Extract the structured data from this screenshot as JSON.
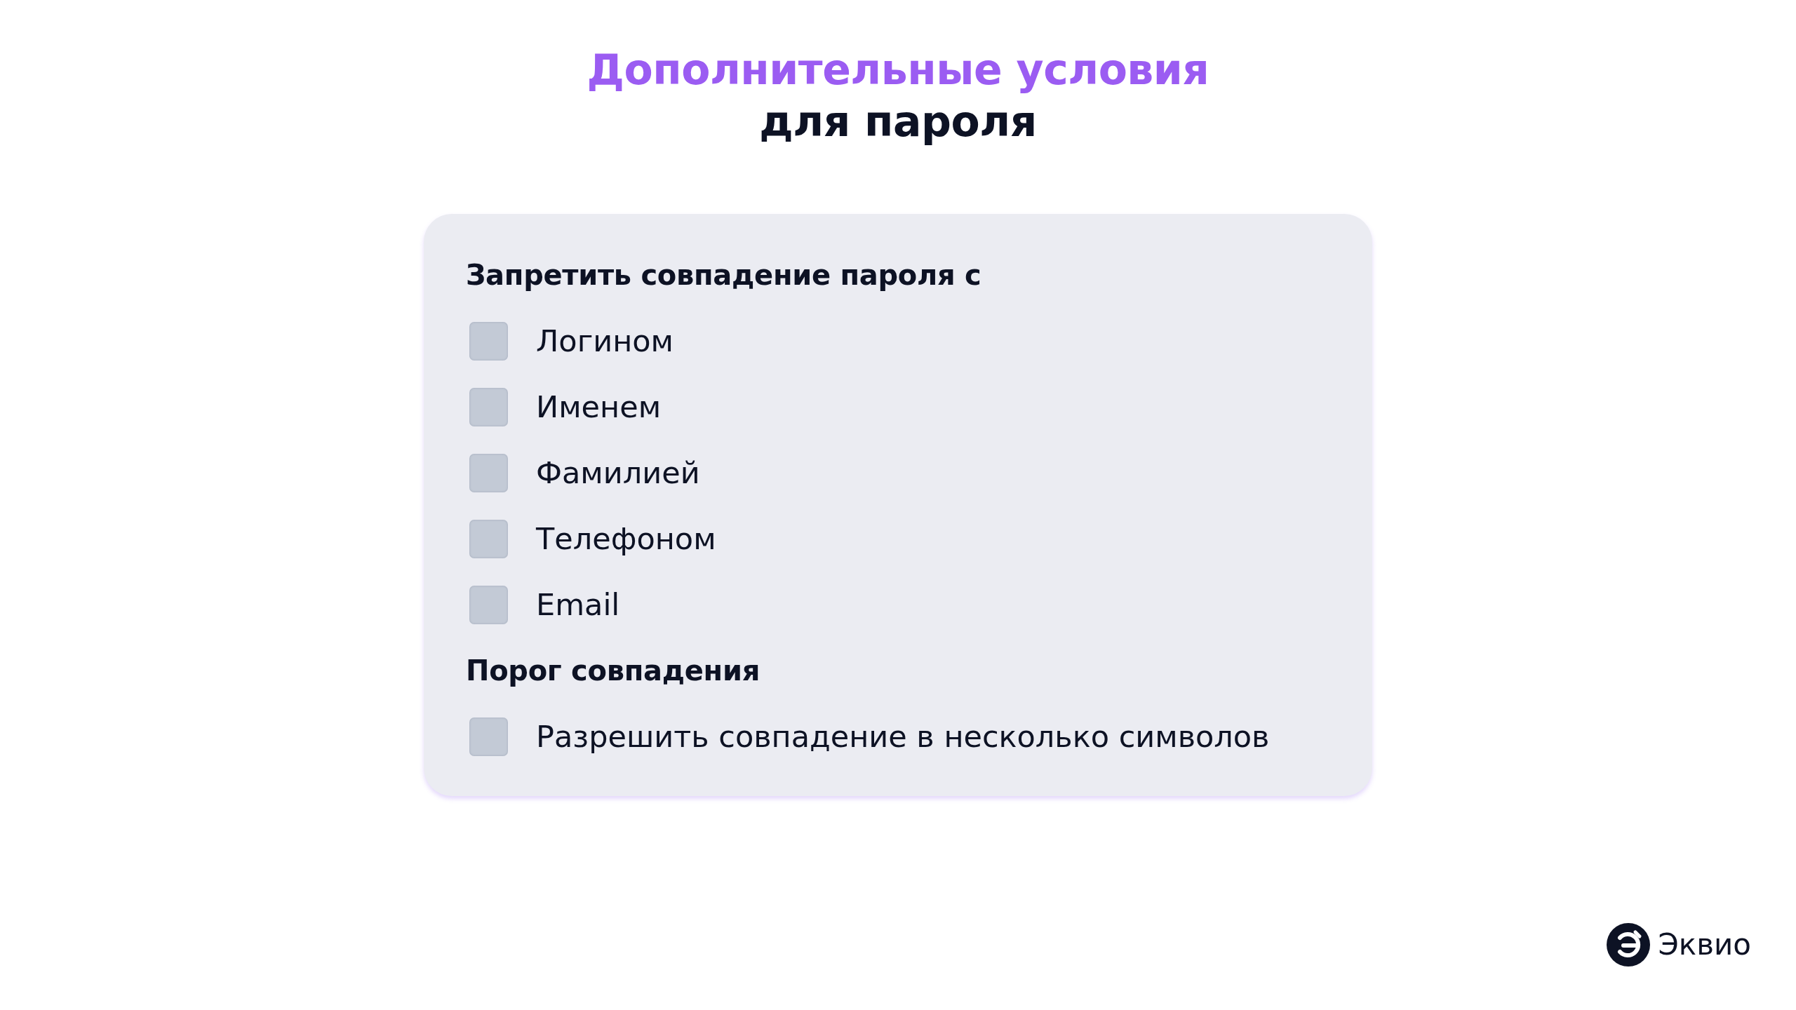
{
  "title": {
    "line_1": "Дополнительные условия",
    "line_2": "для пароля"
  },
  "card": {
    "sections": [
      {
        "heading": "Запретить совпадение пароля с",
        "options": [
          {
            "label": "Логином",
            "checked": false
          },
          {
            "label": "Именем",
            "checked": false
          },
          {
            "label": "Фамилией",
            "checked": false
          },
          {
            "label": "Телефоном",
            "checked": false
          },
          {
            "label": "Email",
            "checked": false
          }
        ]
      },
      {
        "heading": "Порог совпадения",
        "options": [
          {
            "label": "Разрешить совпадение в несколько символов",
            "checked": false
          }
        ]
      }
    ]
  },
  "logo": {
    "text": "Эквио"
  }
}
